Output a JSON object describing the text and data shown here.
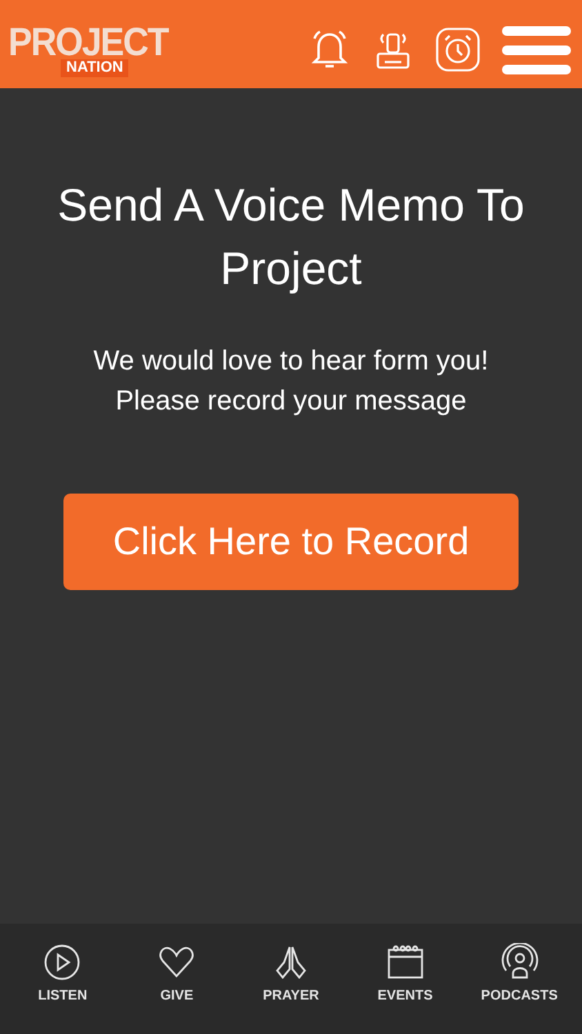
{
  "header": {
    "logo_top": "PROJECT",
    "logo_bottom": "NATION"
  },
  "content": {
    "title": "Send A Voice Memo To Project",
    "message_lines": [
      "We would love to hear form you!",
      "Please record your message"
    ],
    "record_button": "Click Here to Record"
  },
  "tab_bar": [
    {
      "label": "LISTEN",
      "kind": "play"
    },
    {
      "label": "GIVE",
      "kind": "heart"
    },
    {
      "label": "PRAYER",
      "kind": "hands"
    },
    {
      "label": "EVENTS",
      "kind": "calendar"
    },
    {
      "label": "PODCASTS",
      "kind": "podcast"
    }
  ]
}
